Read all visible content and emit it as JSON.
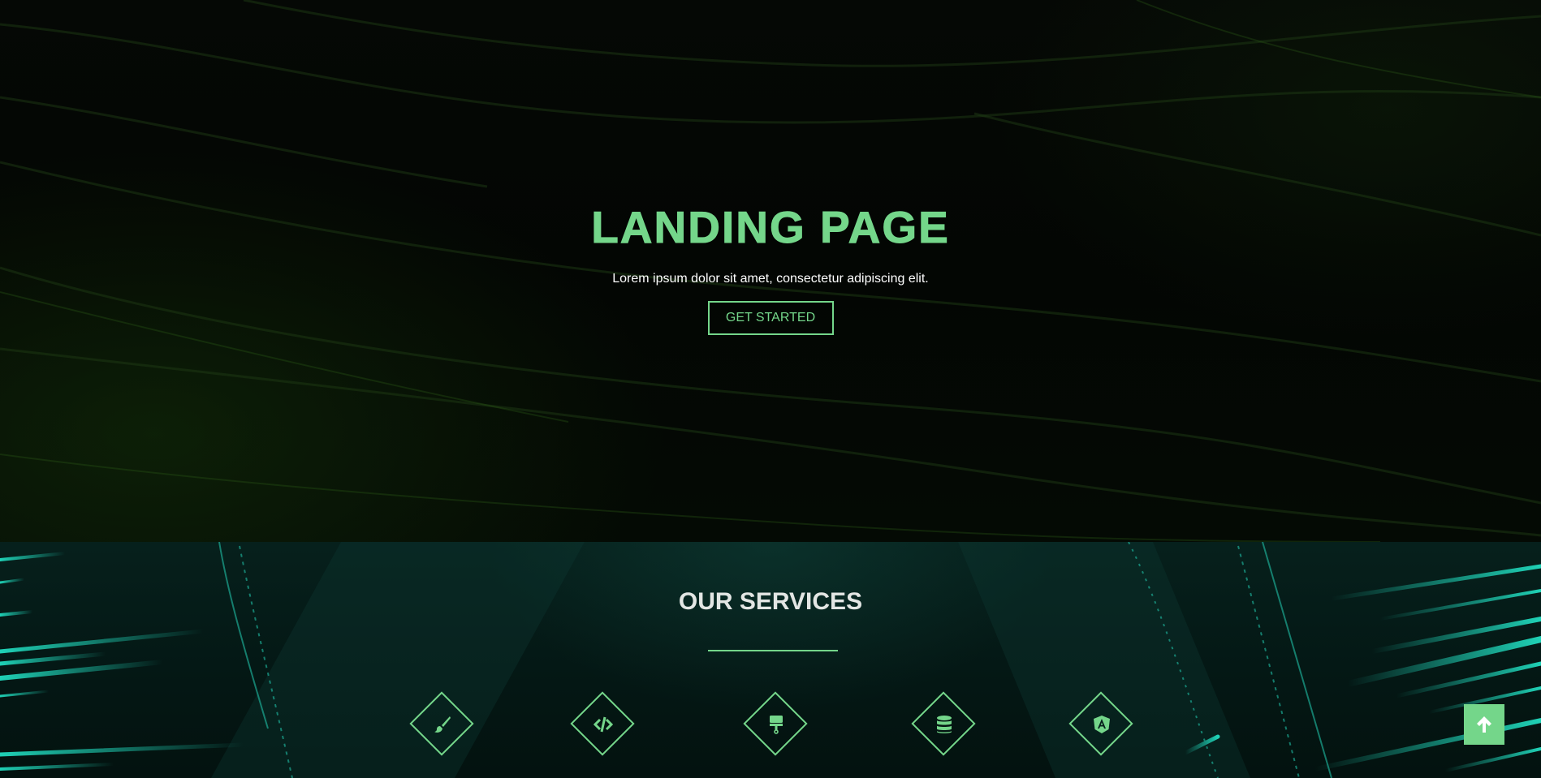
{
  "hero": {
    "title": "LANDING PAGE",
    "subtitle": "Lorem ipsum dolor sit amet, consectetur adipiscing elit.",
    "cta_label": "GET STARTED"
  },
  "services": {
    "title": "OUR SERVICES",
    "items": [
      {
        "icon": "paint-brush-icon"
      },
      {
        "icon": "code-icon"
      },
      {
        "icon": "paint-roller-icon"
      },
      {
        "icon": "database-icon"
      },
      {
        "icon": "angular-icon"
      }
    ]
  },
  "back_to_top": {
    "icon": "arrow-up-icon"
  },
  "colors": {
    "accent": "#74d68a",
    "hero_background": "#040704",
    "services_background": "#06201c",
    "text_light": "#ffffff",
    "services_title": "#e3e6e4"
  }
}
